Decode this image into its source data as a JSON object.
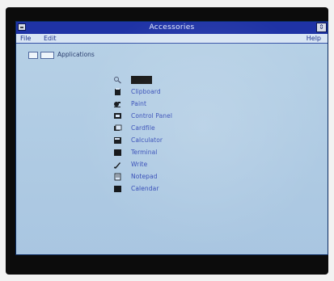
{
  "window": {
    "title": "Accessories",
    "maximize_glyph": "⇕"
  },
  "menu": {
    "file": "File",
    "edit": "Edit",
    "help": "Help"
  },
  "path": {
    "label": "Applications"
  },
  "items": [
    {
      "label": "",
      "icon": "search-icon"
    },
    {
      "label": "Clipboard",
      "icon": "clipboard-icon"
    },
    {
      "label": "Paint",
      "icon": "paint-icon"
    },
    {
      "label": "Control Panel",
      "icon": "control-panel-icon"
    },
    {
      "label": "Cardfile",
      "icon": "cardfile-icon"
    },
    {
      "label": "Calculator",
      "icon": "calculator-icon"
    },
    {
      "label": "Terminal",
      "icon": "terminal-icon"
    },
    {
      "label": "Write",
      "icon": "write-icon"
    },
    {
      "label": "Notepad",
      "icon": "notepad-icon"
    },
    {
      "label": "Calendar",
      "icon": "calendar-icon"
    }
  ]
}
